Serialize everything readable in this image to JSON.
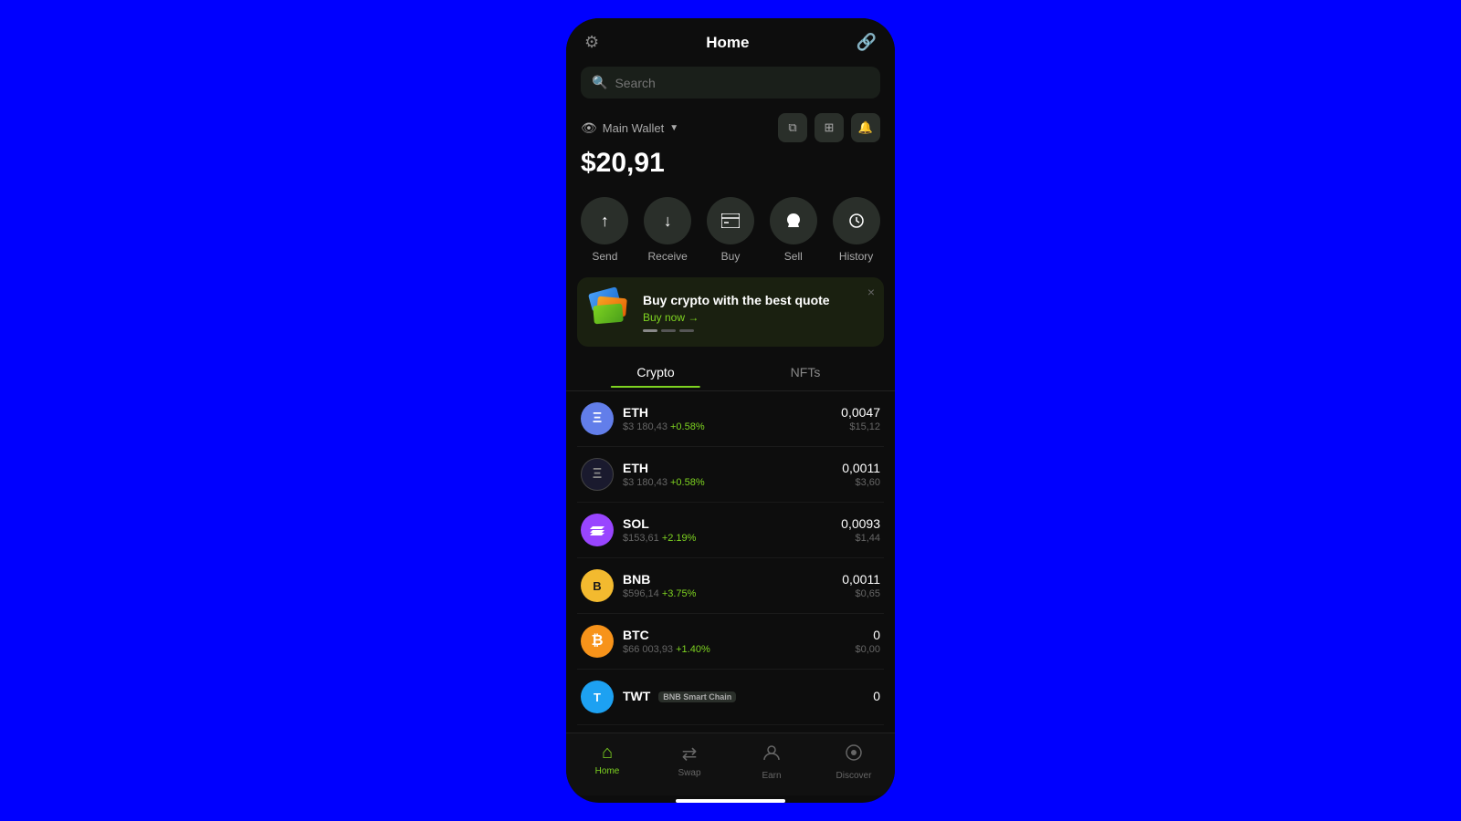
{
  "header": {
    "title": "Home",
    "settings_icon": "⚙",
    "connect_icon": "🔗"
  },
  "search": {
    "placeholder": "Search"
  },
  "wallet": {
    "name": "Main Wallet",
    "balance": "$20,91",
    "icons": [
      "copy",
      "scan",
      "bell"
    ]
  },
  "actions": [
    {
      "id": "send",
      "label": "Send",
      "icon": "↑"
    },
    {
      "id": "receive",
      "label": "Receive",
      "icon": "↓"
    },
    {
      "id": "buy",
      "label": "Buy",
      "icon": "≡"
    },
    {
      "id": "sell",
      "label": "Sell",
      "icon": "🏦"
    },
    {
      "id": "history",
      "label": "History",
      "icon": "⏱"
    }
  ],
  "banner": {
    "title": "Buy crypto with the best quote",
    "link_text": "Buy now →",
    "close_icon": "×"
  },
  "tabs": [
    {
      "id": "crypto",
      "label": "Crypto",
      "active": true
    },
    {
      "id": "nfts",
      "label": "NFTs",
      "active": false
    }
  ],
  "crypto_list": [
    {
      "symbol": "ETH",
      "price": "$3 180,43",
      "change": "+0.58%",
      "amount": "0,0047",
      "value": "$15,12",
      "logo_color": "#627eea",
      "logo_text": "Ξ",
      "chain": null
    },
    {
      "symbol": "ETH",
      "price": "$3 180,43",
      "change": "+0.58%",
      "amount": "0,0011",
      "value": "$3,60",
      "logo_color": "#1a1a2e",
      "logo_text": "Ξ",
      "chain": null
    },
    {
      "symbol": "SOL",
      "price": "$153,61",
      "change": "+2.19%",
      "amount": "0,0093",
      "value": "$1,44",
      "logo_color": "#9945ff",
      "logo_text": "◎",
      "chain": null
    },
    {
      "symbol": "BNB",
      "price": "$596,14",
      "change": "+3.75%",
      "amount": "0,0011",
      "value": "$0,65",
      "logo_color": "#f3ba2f",
      "logo_text": "B",
      "chain": null
    },
    {
      "symbol": "BTC",
      "price": "$66 003,93",
      "change": "+1.40%",
      "amount": "0",
      "value": "$0,00",
      "logo_color": "#f7931a",
      "logo_text": "₿",
      "chain": null
    },
    {
      "symbol": "TWT",
      "price": "",
      "change": "",
      "amount": "0",
      "value": "",
      "logo_color": "#1da1f2",
      "logo_text": "T",
      "chain": "BNB Smart Chain"
    }
  ],
  "bottom_nav": [
    {
      "id": "home",
      "label": "Home",
      "icon": "⌂",
      "active": true
    },
    {
      "id": "swap",
      "label": "Swap",
      "icon": "⇄",
      "active": false
    },
    {
      "id": "earn",
      "label": "Earn",
      "icon": "👤",
      "active": false
    },
    {
      "id": "discover",
      "label": "Discover",
      "icon": "●",
      "active": false
    }
  ]
}
